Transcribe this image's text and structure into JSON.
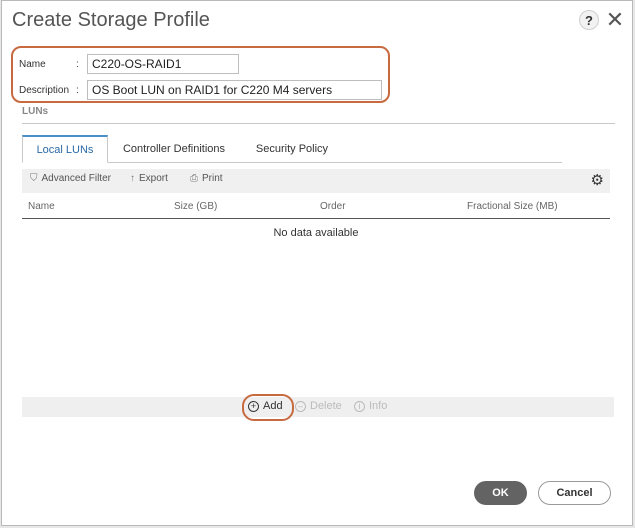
{
  "dialog": {
    "title": "Create Storage Profile",
    "help_label": "?",
    "close_label": "✕"
  },
  "form": {
    "name_label": "Name",
    "name_colon": ":",
    "name_value": "C220-OS-RAID1",
    "description_label": "Description",
    "description_colon": ":",
    "description_value": "OS Boot LUN on RAID1 for C220 M4 servers"
  },
  "luns": {
    "section_title": "LUNs",
    "tabs": [
      {
        "label": "Local LUNs",
        "active": true
      },
      {
        "label": "Controller Definitions",
        "active": false
      },
      {
        "label": "Security Policy",
        "active": false
      }
    ],
    "toolbar": {
      "filter_label": "Advanced Filter",
      "export_label": "Export",
      "print_label": "Print"
    },
    "columns": [
      "Name",
      "Size (GB)",
      "Order",
      "Fractional Size (MB)"
    ],
    "empty_text": "No data available",
    "actions": {
      "add_label": "Add",
      "delete_label": "Delete",
      "info_label": "Info"
    }
  },
  "footer": {
    "ok_label": "OK",
    "cancel_label": "Cancel"
  },
  "colors": {
    "highlight": "#c86a3f",
    "tab_accent": "#4a90c8",
    "ok_bg": "#636363"
  }
}
